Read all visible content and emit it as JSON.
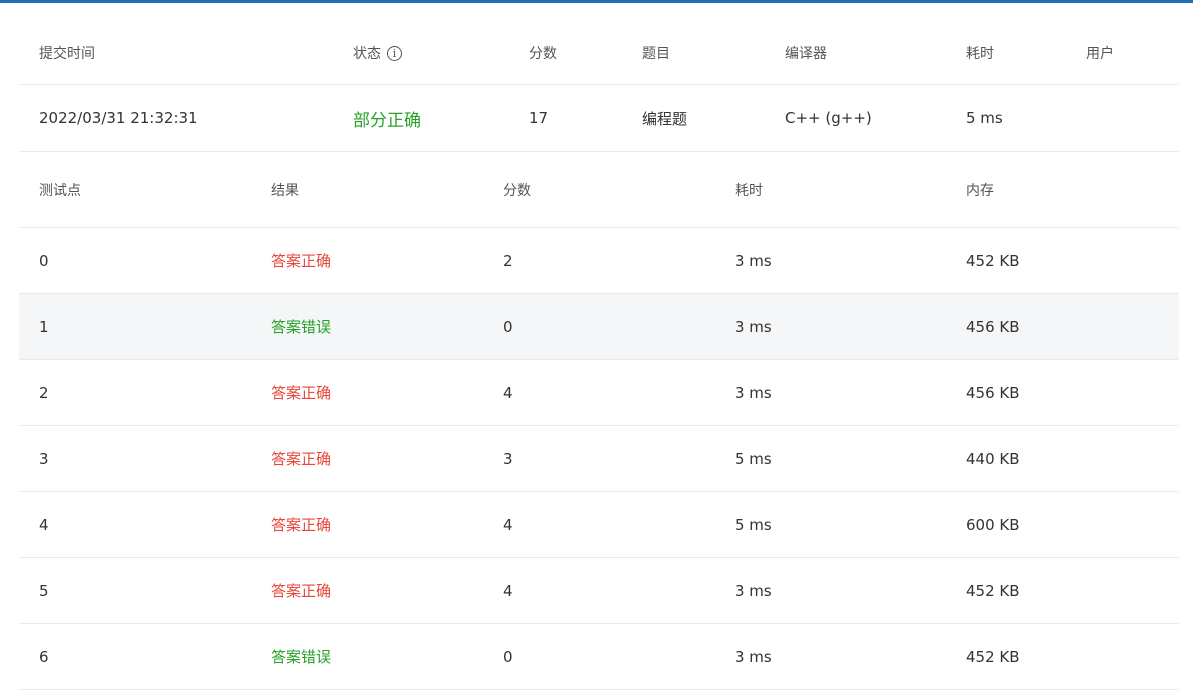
{
  "summary": {
    "headers": {
      "time": "提交时间",
      "status": "状态",
      "score": "分数",
      "problem": "题目",
      "compiler": "编译器",
      "duration": "耗时",
      "user": "用户"
    },
    "row": {
      "time": "2022/03/31 21:32:31",
      "status": "部分正确",
      "score": "17",
      "problem": "编程题",
      "compiler": "C++ (g++)",
      "duration": "5 ms",
      "user": ""
    },
    "info_icon": "info-icon"
  },
  "tests": {
    "headers": {
      "id": "测试点",
      "result": "结果",
      "score": "分数",
      "duration": "耗时",
      "memory": "内存"
    },
    "rows": [
      {
        "id": "0",
        "result": "答案正确",
        "score": "2",
        "duration": "3 ms",
        "memory": "452 KB"
      },
      {
        "id": "1",
        "result": "答案错误",
        "score": "0",
        "duration": "3 ms",
        "memory": "456 KB"
      },
      {
        "id": "2",
        "result": "答案正确",
        "score": "4",
        "duration": "3 ms",
        "memory": "456 KB"
      },
      {
        "id": "3",
        "result": "答案正确",
        "score": "3",
        "duration": "5 ms",
        "memory": "440 KB"
      },
      {
        "id": "4",
        "result": "答案正确",
        "score": "4",
        "duration": "5 ms",
        "memory": "600 KB"
      },
      {
        "id": "5",
        "result": "答案正确",
        "score": "4",
        "duration": "3 ms",
        "memory": "452 KB"
      },
      {
        "id": "6",
        "result": "答案错误",
        "score": "0",
        "duration": "3 ms",
        "memory": "452 KB"
      }
    ]
  },
  "colors": {
    "accent_line": "#1f6fb5",
    "correct": "#e8463a",
    "wrong": "#27a227",
    "partial": "#27a227"
  }
}
